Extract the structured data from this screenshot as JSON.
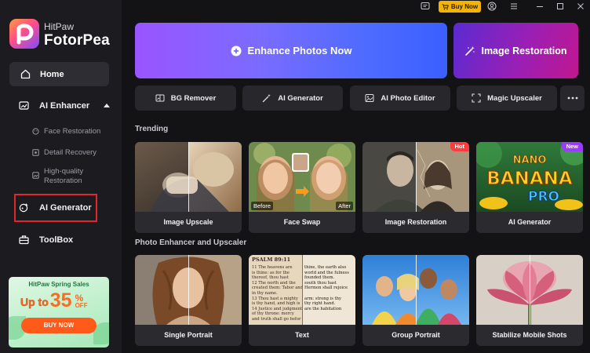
{
  "brand": {
    "small": "HitPaw",
    "name": "FotorPea"
  },
  "topbar": {
    "buy_label": "Buy Now"
  },
  "sidebar": {
    "home": "Home",
    "ai_enhancer": "AI Enhancer",
    "sub_items": [
      "Face Restoration",
      "Detail Recovery",
      "High-quality Restoration"
    ],
    "ai_generator": "AI Generator",
    "toolbox": "ToolBox"
  },
  "promo": {
    "title": "HitPaw Spring Sales",
    "upto": "Up to",
    "number": "35",
    "pct": "%",
    "off": "OFF",
    "button": "BUY NOW"
  },
  "hero": {
    "enhance": "Enhance Photos Now",
    "restoration": "Image Restoration"
  },
  "tools": [
    "BG Remover",
    "AI Generator",
    "AI Photo Editor",
    "Magic Upscaler"
  ],
  "sections": {
    "trending": {
      "title": "Trending",
      "cards": [
        "Image Upscale",
        "Face Swap",
        "Image Restoration",
        "AI Generator"
      ],
      "face_swap_tags": {
        "before": "Before",
        "after": "After"
      },
      "badges": {
        "hot": "Hot",
        "new": "New"
      },
      "ai_gen_art": {
        "line1": "NANO",
        "line2": "BANANA",
        "line3": "PRO"
      }
    },
    "enhancer": {
      "title": "Photo Enhancer and Upscaler",
      "cards": [
        "Single Portrait",
        "Text",
        "Group Portrait",
        "Stabilize Mobile Shots"
      ],
      "text_sample": {
        "heading": "PSALM 89:11",
        "lines": [
          "11 The heavens are",
          "is thine: as for the",
          "thereof, thou hast",
          "12 The north and the",
          "created them: Tabor and",
          "in thy name.",
          "13 Thou hast a mighty",
          "is thy hand, and high is",
          "14 Justice and judgment",
          "of thy throne: mercy",
          "and truth shall go befor"
        ],
        "right_lines": [
          "thine, the earth also",
          "world and the fulness",
          "founded them.",
          "south thou hast",
          "Hermon shall rejoice",
          "",
          "arm: strong is thy",
          "thy right hand.",
          "are the habitation",
          "",
          ""
        ]
      }
    }
  },
  "colors": {
    "accent_red": "#e0272c",
    "buy": "#f4b400",
    "hot": "#ff3b3b",
    "new": "#9b3bff"
  }
}
